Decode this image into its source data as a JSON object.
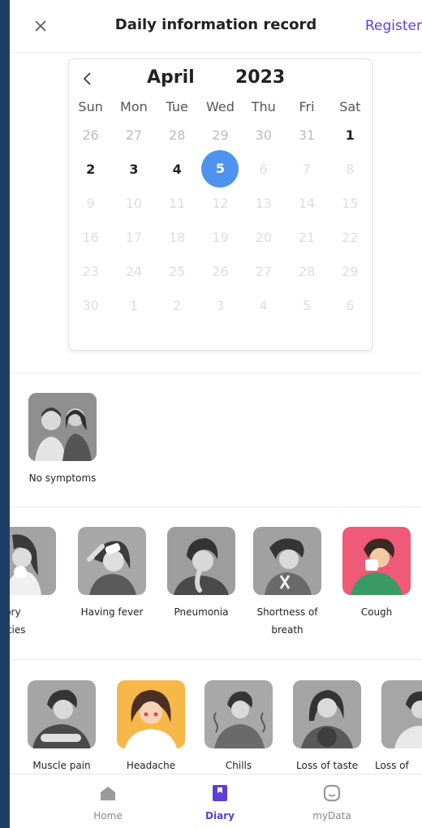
{
  "header": {
    "title": "Daily information record",
    "register_label": "Register"
  },
  "calendar": {
    "month": "April",
    "year": "2023",
    "weekdays": [
      "Sun",
      "Mon",
      "Tue",
      "Wed",
      "Thu",
      "Fri",
      "Sat"
    ],
    "weeks": [
      [
        "26",
        "27",
        "28",
        "29",
        "30",
        "31",
        "1"
      ],
      [
        "2",
        "3",
        "4",
        "5",
        "6",
        "7",
        "8"
      ],
      [
        "9",
        "10",
        "11",
        "12",
        "13",
        "14",
        "15"
      ],
      [
        "16",
        "17",
        "18",
        "19",
        "20",
        "21",
        "22"
      ],
      [
        "23",
        "24",
        "25",
        "26",
        "27",
        "28",
        "29"
      ],
      [
        "30",
        "1",
        "2",
        "3",
        "4",
        "5",
        "6"
      ]
    ],
    "selected_day": "5"
  },
  "symptoms_group1": [
    {
      "label": "No symptoms"
    }
  ],
  "symptoms_group2": [
    {
      "label": "spiratory ormalities"
    },
    {
      "label": "Having fever"
    },
    {
      "label": "Pneumonia"
    },
    {
      "label": "Shortness of breath"
    },
    {
      "label": "Cough"
    }
  ],
  "symptoms_group3": [
    {
      "label": "Muscle pain"
    },
    {
      "label": "Headache"
    },
    {
      "label": "Chills"
    },
    {
      "label": "Loss of taste"
    },
    {
      "label": "Loss of"
    }
  ],
  "nav": {
    "home": "Home",
    "diary": "Diary",
    "mydata": "myData"
  },
  "colors": {
    "accent": "#5b3fd6",
    "selected_day": "#4e93ef",
    "cough_bg": "#ee5a78",
    "headache_bg": "#f7b84a"
  }
}
